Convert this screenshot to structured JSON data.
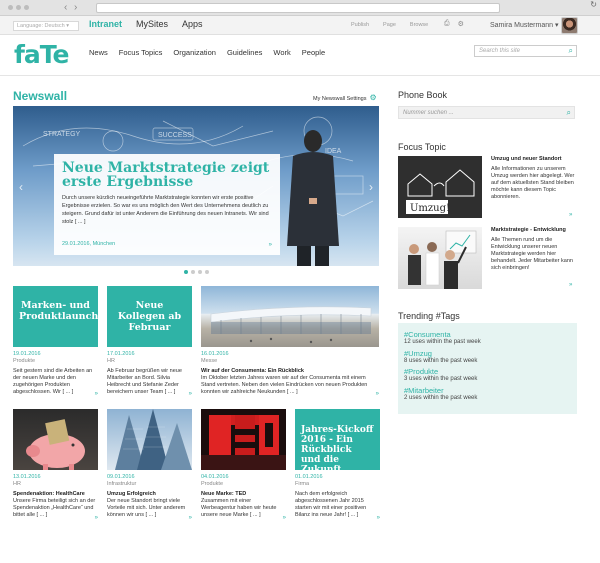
{
  "header_bar": {
    "language": "Language: Deutsch",
    "nav": [
      "Intranet",
      "MySites",
      "Apps"
    ],
    "tools": [
      "Publish",
      "Page",
      "Browse"
    ],
    "user": "Samira Mustermann"
  },
  "site": {
    "logo": "faTe",
    "nav": [
      "News",
      "Focus Topics",
      "Organization",
      "Guidelines",
      "Work",
      "People"
    ],
    "search_placeholder": "Search this site"
  },
  "newswall": {
    "title": "Newswall",
    "settings": "My Newswall Settings",
    "hero": {
      "title": "Neue Marktstrategie zeigt erste Ergebnisse",
      "text": "Durch unsere kürzlich neueingeführte Marktstrategie konnten wir erste positive Ergebnisse erzielen. So war es uns möglich den Wert des Unternehmens deutlich zu steigern. Grund dafür ist unter Anderem die Einführung des neuen Intranets. Wir sind stolz [ ... ]",
      "date": "29.01.2016, München",
      "more": "»"
    },
    "tiles": [
      {
        "image_text": "Marken- und Produktlaunch",
        "date": "19.01.2016",
        "category": "Produkte",
        "headline": "",
        "text": "Seit gestern sind die Arbeiten an der neuen Marke und den zugehörigen Produkten abgeschlossen. Wir [ ... ]"
      },
      {
        "image_text": "Neue Kollegen ab Februar",
        "date": "17.01.2016",
        "category": "HR",
        "headline": "",
        "text": "Ab Februar begrüßen wir neue Mitarbeiter an Bord. Silvia Heibrecht und Stefanie Zeder bereichern unser Team [ ... ]"
      },
      {
        "image_text": "",
        "date": "16.01.2016",
        "category": "Messe",
        "headline": "Wir auf der Consumenta: Ein Rückblick",
        "text": "Im Oktober letzten Jahres waren wir auf der Consumenta mit einem Stand vertreten. Neben den vielen Eindrücken von neuen Produkten konnten wir zahlreiche Neukunden [ ... ]"
      },
      {
        "image_text": "",
        "date": "13.01.2016",
        "category": "HR",
        "headline": "Spendenaktion: HealthCare",
        "text": "Unsere Firma beteiligt sich an der Spendenaktion „HealthCare“ und bittet alle [ ... ]"
      },
      {
        "image_text": "",
        "date": "09.01.2016",
        "category": "Infrastruktur",
        "headline": "Umzug Erfolgreich",
        "text": "Der neue Standort bringt viele Vorteile mit sich. Unter anderem können wir uns [ ... ]"
      },
      {
        "image_text": "",
        "date": "04.01.2016",
        "category": "Produkte",
        "headline": "Neue Marke: TED",
        "text": "Zusammen mit einer Werbeagentur haben wir heute unsere neue Marke [ ... ]"
      },
      {
        "image_text": "Jahres-Kickoff 2016 - Ein Rückblick und die Zukunft",
        "date": "01.01.2016",
        "category": "Firma",
        "headline": "",
        "text": "Nach dem erfolgreich abgeschlossenen Jahr 2015 starten wir mit einer positiven Bilanz ins neue Jahr! [ ... ]"
      }
    ]
  },
  "phonebook": {
    "title": "Phone Book",
    "placeholder": "Nummer suchen ..."
  },
  "focus": {
    "title": "Focus Topic",
    "items": [
      {
        "title": "Umzug und neuer Standort",
        "text": "Alle Informationen zu unserem Umzug werden hier abgelegt. Wer auf dem aktuellsten Stand bleiben möchte kann diesem Topic abonnieren.",
        "image_text": "Umzug!"
      },
      {
        "title": "Marktstrategie - Entwicklung",
        "text": "Alle Themen rund um die Entwicklung unserer neuen Marktstrategie werden hier behandelt. Jeder Mitarbeiter kann sich einbringen!"
      }
    ]
  },
  "trending": {
    "title": "Trending #Tags",
    "tags": [
      {
        "tag": "#Consumenta",
        "uses": "12 uses within the past week"
      },
      {
        "tag": "#Umzug",
        "uses": "8 uses within the past week"
      },
      {
        "tag": "#Produkte",
        "uses": "3 uses within the past week"
      },
      {
        "tag": "#Mitarbeiter",
        "uses": "2 uses within the past week"
      }
    ]
  },
  "colors": {
    "accent": "#2fb3a6",
    "trend_bg": "#e6f4f2"
  }
}
